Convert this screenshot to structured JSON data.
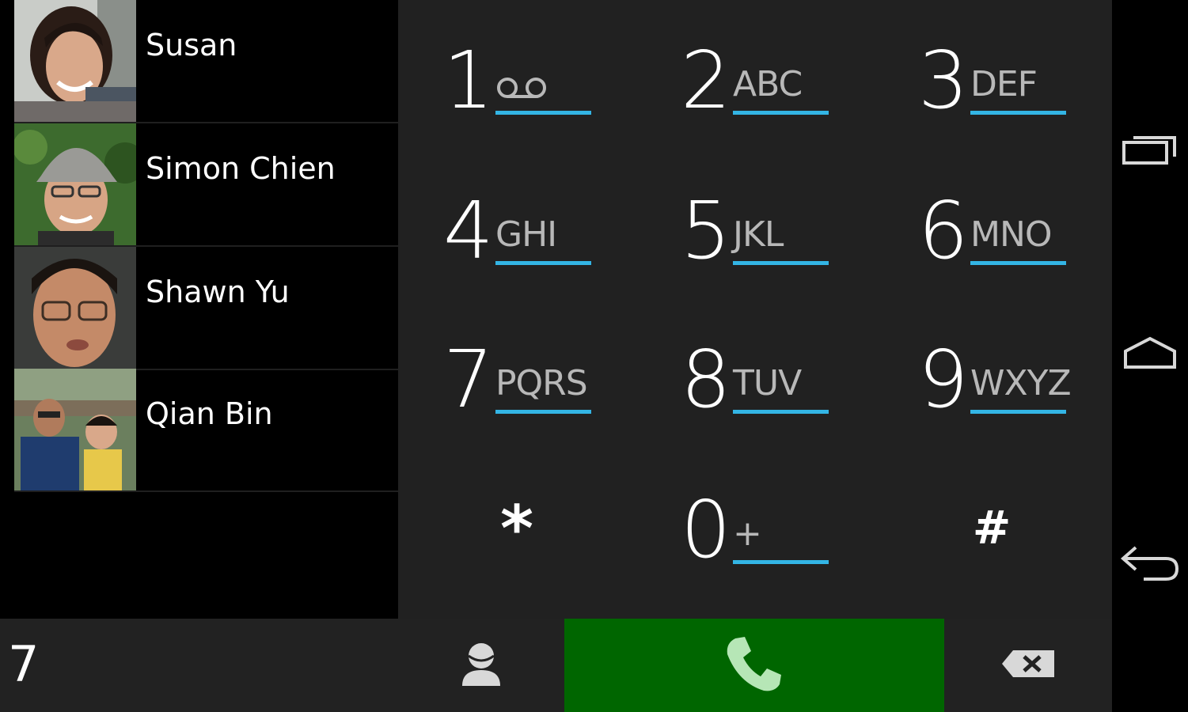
{
  "contacts": [
    {
      "name": "Susan"
    },
    {
      "name": "Simon Chien"
    },
    {
      "name": "Shawn Yu"
    },
    {
      "name": "Qian Bin"
    }
  ],
  "keypad": {
    "keys": [
      {
        "digit": "1",
        "letters": "",
        "icon": "voicemail-icon"
      },
      {
        "digit": "2",
        "letters": "ABC"
      },
      {
        "digit": "3",
        "letters": "DEF"
      },
      {
        "digit": "4",
        "letters": "GHI"
      },
      {
        "digit": "5",
        "letters": "JKL"
      },
      {
        "digit": "6",
        "letters": "MNO"
      },
      {
        "digit": "7",
        "letters": "PQRS"
      },
      {
        "digit": "8",
        "letters": "TUV"
      },
      {
        "digit": "9",
        "letters": "WXYZ"
      },
      {
        "digit": "*",
        "letters": ""
      },
      {
        "digit": "0",
        "letters": "+"
      },
      {
        "digit": "#",
        "letters": ""
      }
    ]
  },
  "dialer": {
    "typed_number": "7",
    "contacts_icon": "person-icon",
    "call_icon": "phone-icon",
    "backspace_icon": "backspace-icon"
  },
  "navigation": {
    "recents_icon": "recent-apps-icon",
    "home_icon": "home-icon",
    "back_icon": "back-icon"
  },
  "colors": {
    "accent": "#33b5e5",
    "call_button": "#006600",
    "keypad_bg": "#212121"
  }
}
